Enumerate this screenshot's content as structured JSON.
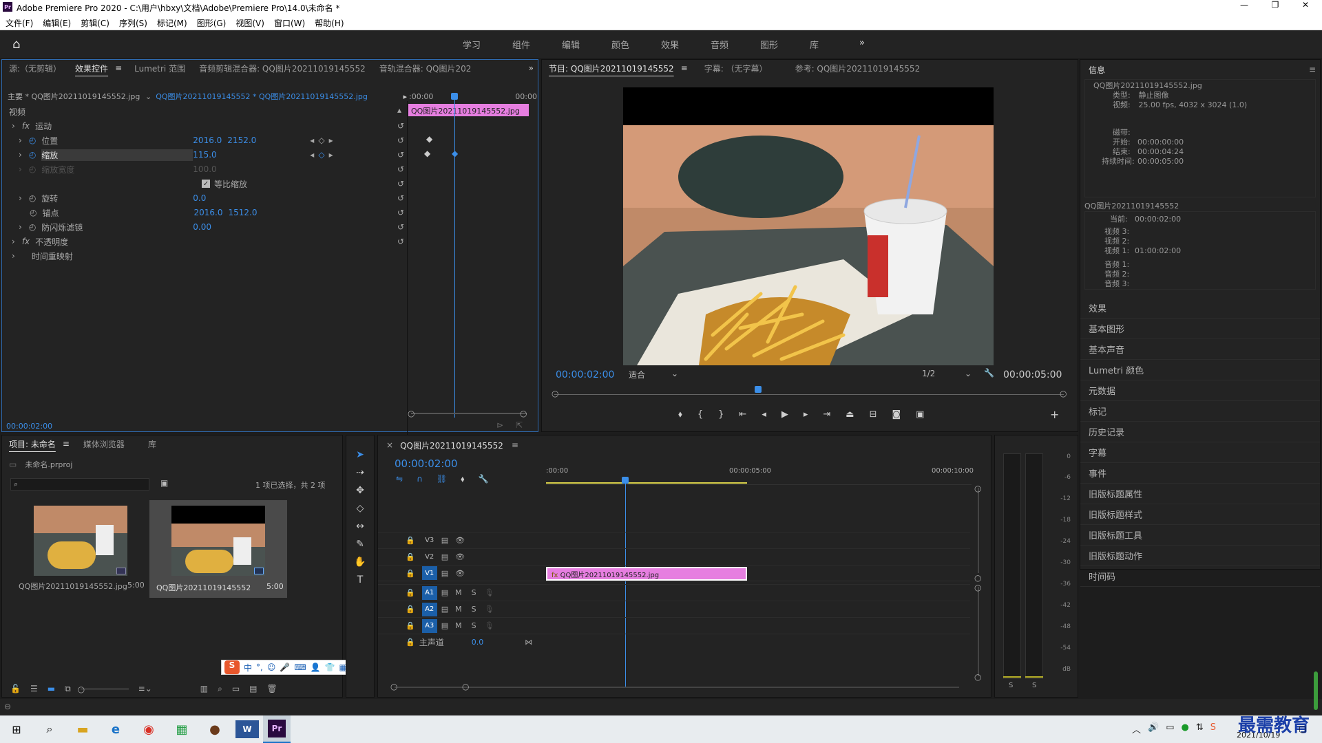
{
  "window": {
    "title": "Adobe Premiere Pro 2020 - C:\\用户\\hbxy\\文档\\Adobe\\Premiere Pro\\14.0\\未命名 *",
    "app_icon": "Pr"
  },
  "menu": [
    "文件(F)",
    "编辑(E)",
    "剪辑(C)",
    "序列(S)",
    "标记(M)",
    "图形(G)",
    "视图(V)",
    "窗口(W)",
    "帮助(H)"
  ],
  "workspaces": [
    "学习",
    "组件",
    "编辑",
    "颜色",
    "效果",
    "音频",
    "图形",
    "库"
  ],
  "effect_controls": {
    "tabs": [
      "源:（无剪辑）",
      "效果控件",
      "Lumetri 范围",
      "音频剪辑混合器: QQ图片20211019145552",
      "音轨混合器: QQ图片202"
    ],
    "master": "主要 * QQ图片20211019145552.jpg",
    "clip_path": "QQ图片20211019145552 * QQ图片20211019145552.jpg",
    "timeline_start": ":00:00",
    "timeline_end": "00:00",
    "clip_label": "QQ图片20211019145552.jpg",
    "section_video": "视频",
    "motion": "运动",
    "props": [
      {
        "name": "位置",
        "v1": "2016.0",
        "v2": "2152.0"
      },
      {
        "name": "缩放",
        "v1": "115.0",
        "v2": ""
      },
      {
        "name": "缩放宽度",
        "v1": "100.0",
        "v2": ""
      },
      {
        "name": "旋转",
        "v1": "0.0",
        "v2": ""
      },
      {
        "name": "锚点",
        "v1": "2016.0",
        "v2": "1512.0"
      },
      {
        "name": "防闪烁滤镜",
        "v1": "0.00",
        "v2": ""
      }
    ],
    "uniform_scale": "等比缩放",
    "opacity": "不透明度",
    "time_remap": "时间重映射",
    "current_time": "00:00:02:00"
  },
  "program": {
    "tabs": [
      "节目: QQ图片20211019145552",
      "字幕: （无字幕）",
      "参考: QQ图片20211019145552"
    ],
    "timecode": "00:00:02:00",
    "fit": "适合",
    "resolution": "1/2",
    "duration": "00:00:05:00",
    "playhead_fraction": 0.4
  },
  "info": {
    "title": "信息",
    "file": "QQ图片20211019145552.jpg",
    "type_label": "类型:",
    "type_value": "静止图像",
    "video_label": "视频:",
    "video_value": "25.00 fps, 4032 x 3024 (1.0)",
    "tape_label": "磁带:",
    "in_label": "开始:",
    "in_value": "00:00:00:00",
    "out_label": "结束:",
    "out_value": "00:00:04:24",
    "dur_label": "持续时间:",
    "dur_value": "00:00:05:00",
    "seq": "QQ图片20211019145552",
    "current_label": "当前:",
    "current_value": "00:00:02:00",
    "v3": "视频 3:",
    "v2": "视频 2:",
    "v1": "视频 1:",
    "v1_value": "01:00:02:00",
    "a1": "音频 1:",
    "a2": "音频 2:",
    "a3": "音频 3:"
  },
  "right_panels": [
    "效果",
    "基本图形",
    "基本声音",
    "Lumetri 颜色",
    "元数据",
    "标记",
    "历史记录",
    "字幕",
    "事件",
    "旧版标题属性",
    "旧版标题样式",
    "旧版标题工具",
    "旧版标题动作",
    "时间码"
  ],
  "project": {
    "tabs": [
      "项目: 未命名",
      "媒体浏览器",
      "库"
    ],
    "file": "未命名.prproj",
    "selection": "1 项已选择，共 2 项",
    "items": [
      {
        "name": "QQ图片20211019145552.jpg",
        "dur": "5:00"
      },
      {
        "name": "QQ图片20211019145552",
        "dur": "5:00"
      }
    ]
  },
  "timeline": {
    "tab": "QQ图片20211019145552",
    "timecode": "00:00:02:00",
    "ruler": [
      ":00:00",
      "00:00:05:00",
      "00:00:10:00"
    ],
    "clip": "QQ图片20211019145552.jpg",
    "video_tracks": [
      "V3",
      "V2",
      "V1"
    ],
    "audio_tracks": [
      "A1",
      "A2",
      "A3"
    ],
    "master": "主声道",
    "master_value": "0.0"
  },
  "meter_ticks": [
    "0",
    "-6",
    "-12",
    "-18",
    "-24",
    "-30",
    "-36",
    "-42",
    "-48",
    "-54",
    "dB"
  ],
  "meter_buttons": [
    "S",
    "S"
  ],
  "ime": "中",
  "taskbar": {
    "date": "2021/10/19",
    "watermark": "最需教育"
  }
}
